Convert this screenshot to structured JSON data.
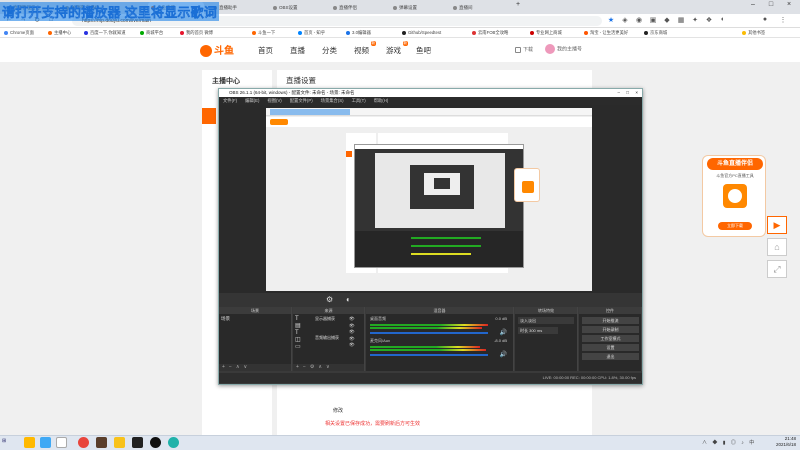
{
  "overlay_text": "请打开支持的播放器 这里将显示歌词",
  "browser": {
    "tabs": [
      {
        "label": "直播管理后台"
      },
      {
        "label": "关键字,直播优"
      },
      {
        "label": "斗鱼直播"
      },
      {
        "label": "直播助手"
      },
      {
        "label": "OBS设置"
      },
      {
        "label": "直播伴侣"
      },
      {
        "label": "弹幕设置"
      },
      {
        "label": "直播间"
      }
    ],
    "url": "https://mp.douyu.com/live/main",
    "bookmarks": [
      {
        "label": "Chrome页面",
        "color": "#4285f4"
      },
      {
        "label": "主播中心",
        "color": "#f60"
      },
      {
        "label": "百度一下,你就知道",
        "color": "#2932e1"
      },
      {
        "label": "商城平台",
        "color": "#0a0"
      },
      {
        "label": "我的首页 微博",
        "color": "#e6162d"
      },
      {
        "label": "斗鱼一下",
        "color": "#f60"
      },
      {
        "label": "首页 - 知乎",
        "color": "#0084ff"
      },
      {
        "label": "3.0编辑器",
        "color": "#1a73e8"
      },
      {
        "label": "Github/Speedtest",
        "color": "#222"
      },
      {
        "label": "云南FOB全攻略",
        "color": "#d33"
      },
      {
        "label": "专业网上商城",
        "color": "#c00"
      },
      {
        "label": "淘宝 - 让生活更美好",
        "color": "#f50"
      },
      {
        "label": "京东商城",
        "color": "#222"
      },
      {
        "label": "其他书签",
        "color": "#fbbc04"
      }
    ]
  },
  "site": {
    "logo": "斗鱼",
    "nav": [
      {
        "label": "首页"
      },
      {
        "label": "直播"
      },
      {
        "label": "分类"
      },
      {
        "label": "视频",
        "badge": "新"
      },
      {
        "label": "游戏",
        "badge": "新"
      },
      {
        "label": "鱼吧"
      }
    ],
    "user": {
      "download": "下载",
      "name": "我的主播号"
    },
    "sidebar_title": "主播中心",
    "content_title": "直播设置",
    "note1": "修改",
    "note2": "相关设置已保存成功，需要刷新后方可生效",
    "promo": {
      "title": "斗鱼直播伴侣",
      "subtitle": "斗鱼官方PC直播工具",
      "download": "立即下载"
    }
  },
  "obs": {
    "title": "OBS 26.1.1 (64-bit, windows) - 配置文件: 未命名 - 场景: 未命名",
    "menu": [
      "文件(F)",
      "编辑(E)",
      "视图(V)",
      "配置文件(P)",
      "场景集合(S)",
      "工具(T)",
      "帮助(H)"
    ],
    "docks": [
      {
        "title": "场景",
        "items": [
          "场景"
        ]
      },
      {
        "title": "来源",
        "items": [
          "显示器捕获",
          "音频输出捕获"
        ]
      },
      {
        "title": "混音器",
        "items": [
          "桌面音频",
          "麦克风/Aux"
        ]
      },
      {
        "title": "转场特效",
        "items": [
          "淡入淡出",
          "时长 300 ms"
        ]
      },
      {
        "title": "控件",
        "items": [
          "开始推流",
          "开始录制",
          "工作室模式",
          "设置",
          "退出"
        ]
      }
    ],
    "mixer_db": [
      "0.0 dB",
      "-8.0 dB"
    ],
    "status": "LIVE: 00:00:00   REC: 00:00:00   CPU: 1.8%, 30.00 fps"
  },
  "taskbar": {
    "time": "21:48",
    "date": "2021/6/18"
  },
  "colors": {
    "accent": "#ff6600",
    "obs_bg": "#2a2a2a"
  }
}
